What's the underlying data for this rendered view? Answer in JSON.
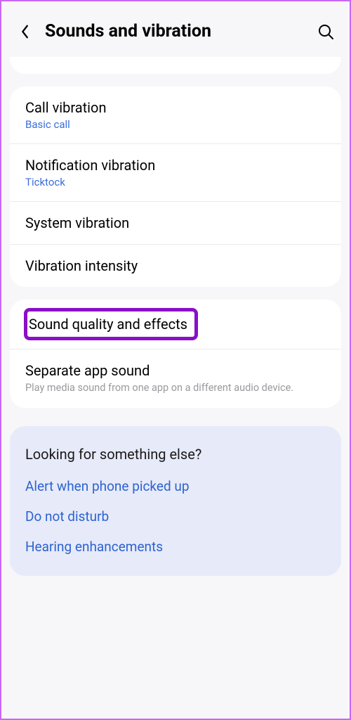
{
  "header": {
    "title": "Sounds and vibration"
  },
  "card1": {
    "items": [
      {
        "title": "Call vibration",
        "subtitle": "Basic call"
      },
      {
        "title": "Notification vibration",
        "subtitle": "Ticktock"
      },
      {
        "title": "System vibration"
      },
      {
        "title": "Vibration intensity"
      }
    ]
  },
  "card2": {
    "items": [
      {
        "title": "Sound quality and effects"
      },
      {
        "title": "Separate app sound",
        "description": "Play media sound from one app on a different audio device."
      }
    ]
  },
  "info": {
    "title": "Looking for something else?",
    "links": [
      "Alert when phone picked up",
      "Do not disturb",
      "Hearing enhancements"
    ]
  }
}
